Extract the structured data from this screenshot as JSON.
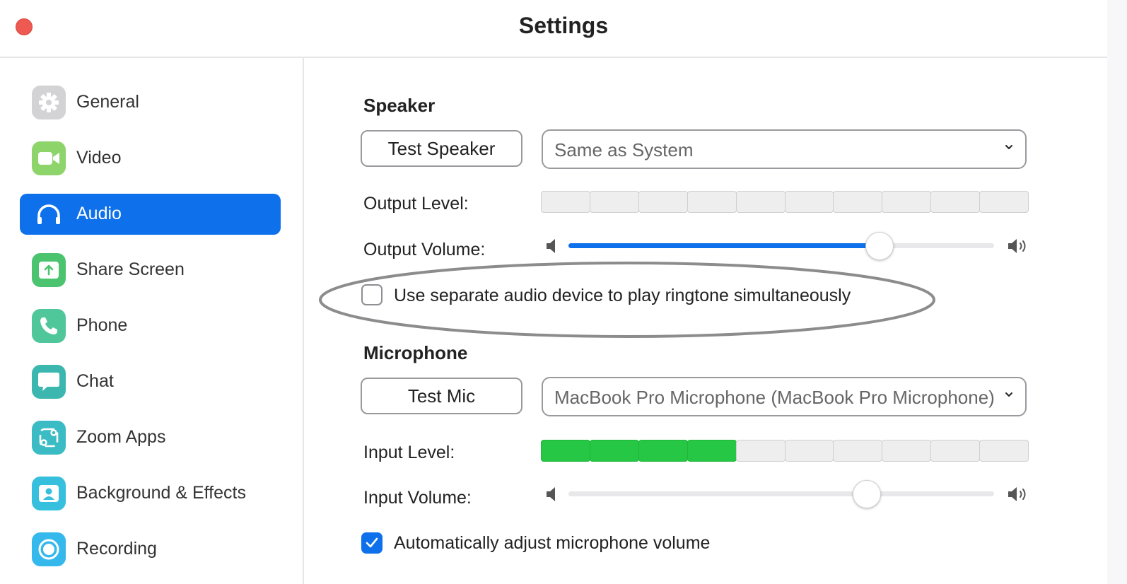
{
  "window": {
    "title": "Settings"
  },
  "sidebar": {
    "items": [
      {
        "label": "General",
        "icon": "gear-icon",
        "color": "#cfcfd2",
        "active": false
      },
      {
        "label": "Video",
        "icon": "video-camera-icon",
        "color": "#8dd46a",
        "active": false
      },
      {
        "label": "Audio",
        "icon": "headphones-icon",
        "color": "#0e71eb",
        "active": true
      },
      {
        "label": "Share Screen",
        "icon": "share-screen-icon",
        "color": "#4cc46f",
        "active": false
      },
      {
        "label": "Phone",
        "icon": "phone-icon",
        "color": "#4fc79a",
        "active": false
      },
      {
        "label": "Chat",
        "icon": "chat-bubble-icon",
        "color": "#3bb7b0",
        "active": false
      },
      {
        "label": "Zoom Apps",
        "icon": "zoom-apps-icon",
        "color": "#3bbcc4",
        "active": false
      },
      {
        "label": "Background & Effects",
        "icon": "background-person-icon",
        "color": "#36c0de",
        "active": false
      },
      {
        "label": "Recording",
        "icon": "record-icon",
        "color": "#35b8ec",
        "active": false
      }
    ]
  },
  "speaker": {
    "heading": "Speaker",
    "test_button": "Test Speaker",
    "device": "Same as System",
    "output_level_label": "Output Level:",
    "output_level_active_segments": 0,
    "output_volume_label": "Output Volume:",
    "output_volume_fraction": 0.73,
    "ringtone_checkbox_label": "Use separate audio device to play ringtone simultaneously",
    "ringtone_checked": false
  },
  "microphone": {
    "heading": "Microphone",
    "test_button": "Test Mic",
    "device": "MacBook Pro Microphone (MacBook Pro Microphone)",
    "input_level_label": "Input Level:",
    "input_level_active_segments": 4,
    "input_volume_label": "Input Volume:",
    "input_volume_fraction": 0.7,
    "auto_adjust_label": "Automatically adjust microphone volume",
    "auto_adjust_checked": true
  },
  "meter_segments_total": 10,
  "colors": {
    "accent": "#0e71eb",
    "level_on": "#26c744",
    "close": "#ee5a52"
  }
}
